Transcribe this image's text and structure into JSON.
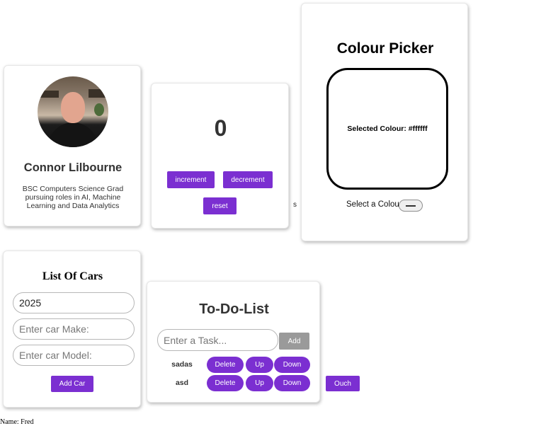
{
  "profile": {
    "name": "Connor Lilbourne",
    "bio": "BSC Computers Science Grad pursuing roles in AI, Machine Learning and Data Analytics"
  },
  "counter": {
    "value": "0",
    "increment_label": "increment",
    "decrement_label": "decrement",
    "reset_label": "reset"
  },
  "colour_picker": {
    "title": "Colour Picker",
    "selected_text": "Selected Colour: #ffffff",
    "selected_colour": "#ffffff",
    "select_label": "Select a Colour"
  },
  "stray_text": "s",
  "cars": {
    "title": "List Of Cars",
    "year_value": "2025",
    "make_placeholder": "Enter car Make:",
    "model_placeholder": "Enter car Model:",
    "add_label": "Add Car"
  },
  "todo": {
    "title": "To-Do-List",
    "task_placeholder": "Enter a Task...",
    "add_label": "Add",
    "tasks": [
      {
        "text": "sadas",
        "delete": "Delete",
        "up": "Up",
        "down": "Down"
      },
      {
        "text": "asd",
        "delete": "Delete",
        "up": "Up",
        "down": "Down"
      }
    ]
  },
  "ouch_label": "Ouch",
  "footer": {
    "name_text": "Name: Fred"
  },
  "colors": {
    "accent": "#7b2fd1",
    "add_grey": "#9a9a9a"
  }
}
